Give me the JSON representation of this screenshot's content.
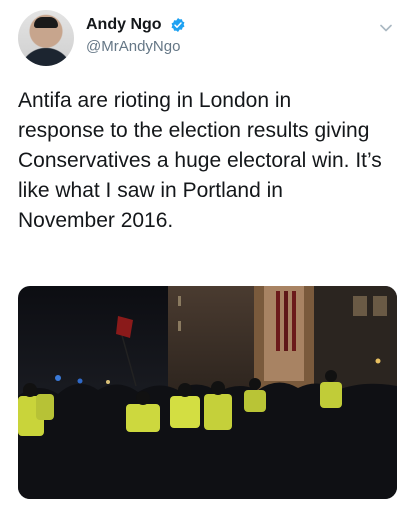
{
  "tweet": {
    "author_name": "Andy Ngo",
    "author_handle": "@MrAndyNgo",
    "text": "Antifa are rioting in London in\nresponse to the election results giving\nConservatives a huge electoral win. It’s\nlike what I saw in Portland in\nNovember 2016.",
    "icons": {
      "verified": "verified-badge-icon",
      "menu": "chevron-down-icon"
    },
    "colors": {
      "verified": "#1da1f2",
      "handle": "#657786",
      "text": "#14171a"
    }
  }
}
